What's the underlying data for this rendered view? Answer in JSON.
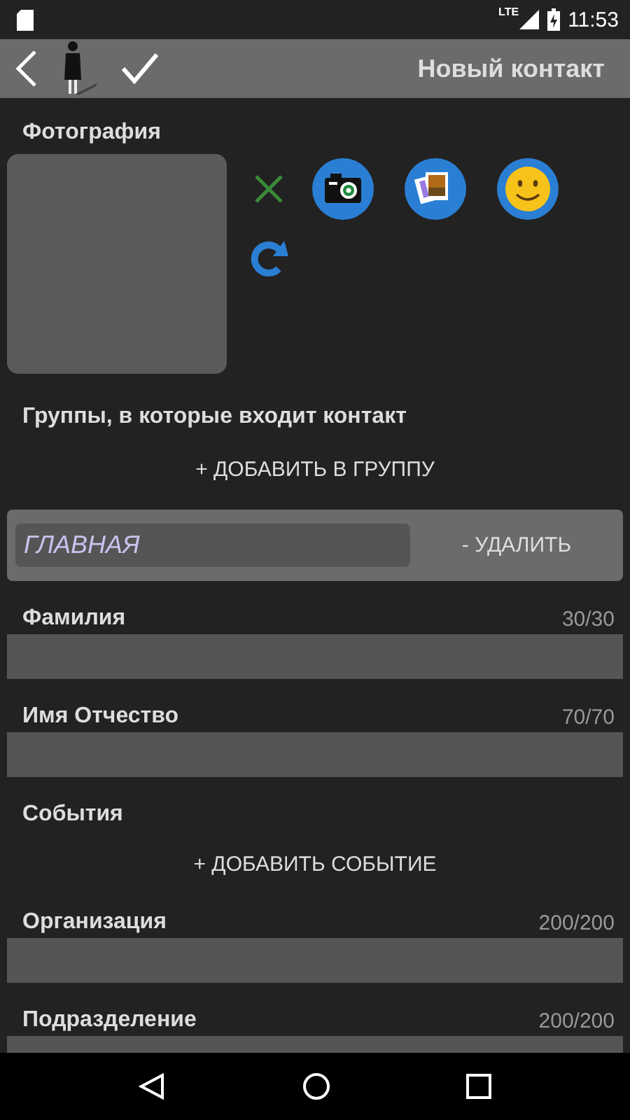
{
  "status_bar": {
    "network": "LTE",
    "time": "11:53"
  },
  "toolbar": {
    "title": "Новый контакт"
  },
  "photo": {
    "label": "Фотография"
  },
  "groups": {
    "label": "Группы, в которые входит контакт",
    "add_action": "+ ДОБАВИТЬ В ГРУППУ",
    "items": [
      {
        "name": "ГЛАВНАЯ",
        "remove_action": "- УДАЛИТЬ"
      }
    ]
  },
  "fields": [
    {
      "kind": "text",
      "label": "Фамилия",
      "counter": "30/30"
    },
    {
      "kind": "text",
      "label": "Имя Отчество",
      "counter": "70/70"
    },
    {
      "kind": "events",
      "label": "События",
      "add_action": "+ ДОБАВИТЬ СОБЫТИЕ"
    },
    {
      "kind": "text",
      "label": "Организация",
      "counter": "200/200"
    },
    {
      "kind": "text",
      "label": "Подразделение",
      "counter": "200/200"
    }
  ]
}
